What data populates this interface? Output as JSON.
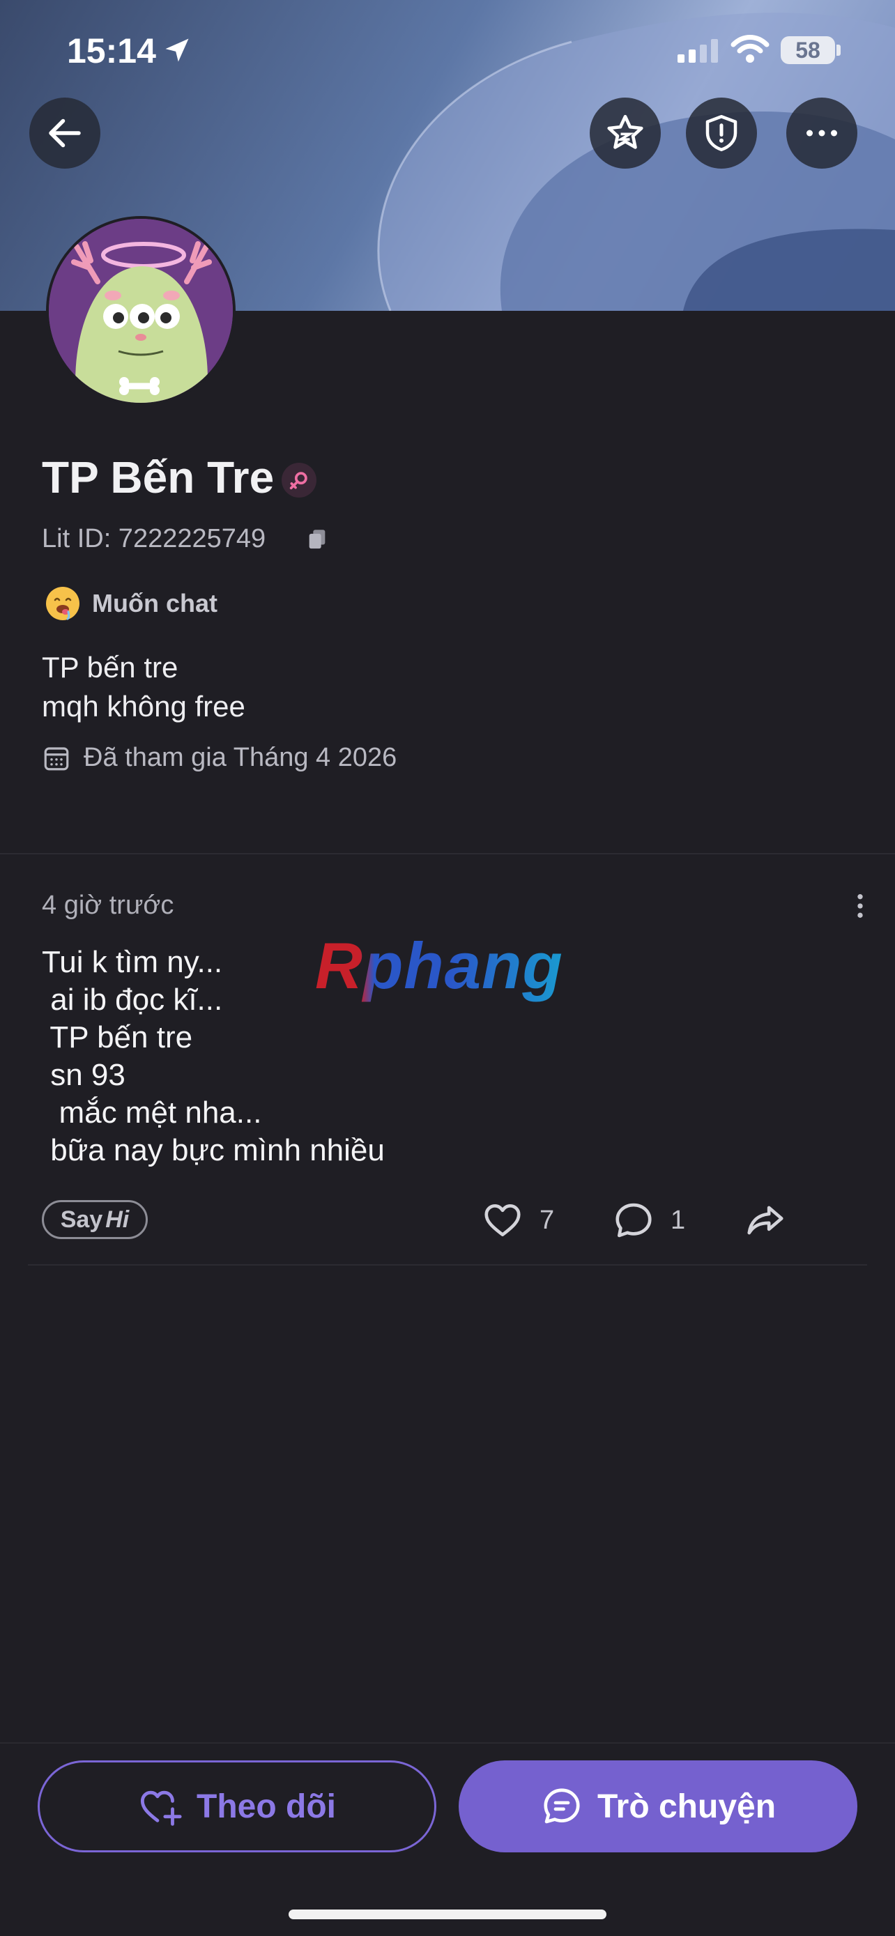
{
  "status_bar": {
    "time": "15:14",
    "battery": "58"
  },
  "profile": {
    "name": "TP Bến Tre",
    "lit_id": "Lit ID: 7222225749",
    "mood": "Muốn chat",
    "bio_line1": "TP bến tre",
    "bio_line2": "mqh không free",
    "joined": "Đã tham gia Tháng 4 2026"
  },
  "post": {
    "time": "4 giờ trước",
    "text": "Tui k tìm ny...\n ai ib đọc kĩ...\n TP bến tre\n sn 93\n  mắc mệt nha...\n bữa nay bực mình nhiều",
    "watermark": "Rphang",
    "say_label": "Say",
    "hi_label": "Hi",
    "likes": "7",
    "comments": "1"
  },
  "actions": {
    "follow_label": "Theo dõi",
    "chat_label": "Trò chuyện"
  },
  "colors": {
    "accent": "#7561cf",
    "background": "#1f1e24"
  }
}
